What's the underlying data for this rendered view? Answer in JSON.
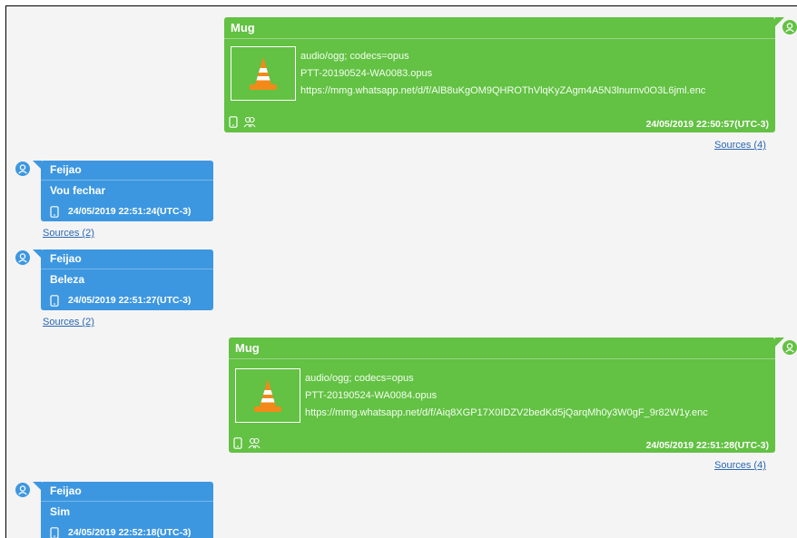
{
  "messages": [
    {
      "sender": "Mug",
      "mime": "audio/ogg; codecs=opus",
      "filename": "PTT-20190524-WA0083.opus",
      "url": "https://mmg.whatsapp.net/d/f/AlB8uKgOM9QHROThVlqKyZAgm4A5N3lnurnv0O3L6jml.enc",
      "timestamp": "24/05/2019 22:50:57(UTC-3)",
      "sources": "Sources (4)"
    },
    {
      "sender": "Feijao",
      "text": "Vou fechar",
      "timestamp": "24/05/2019 22:51:24(UTC-3)",
      "sources": "Sources (2)"
    },
    {
      "sender": "Feijao",
      "text": "Beleza",
      "timestamp": "24/05/2019 22:51:27(UTC-3)",
      "sources": "Sources (2)"
    },
    {
      "sender": "Mug",
      "mime": "audio/ogg; codecs=opus",
      "filename": "PTT-20190524-WA0084.opus",
      "url": "https://mmg.whatsapp.net/d/f/Aiq8XGP17X0IDZV2bedKd5jQarqMh0y3W0gF_9r82W1y.enc",
      "timestamp": "24/05/2019 22:51:28(UTC-3)",
      "sources": "Sources (4)"
    },
    {
      "sender": "Feijao",
      "text": "Sim",
      "timestamp": "24/05/2019 22:52:18(UTC-3)"
    }
  ],
  "icons": {
    "avatar": "user-avatar-icon",
    "device": "phone-icon",
    "contacts": "contacts-icon",
    "media": "vlc-cone-icon"
  },
  "colors": {
    "outgoing": "#63c144",
    "incoming": "#3d97e0",
    "link": "#2b67b3",
    "background": "#f4f4f4"
  }
}
